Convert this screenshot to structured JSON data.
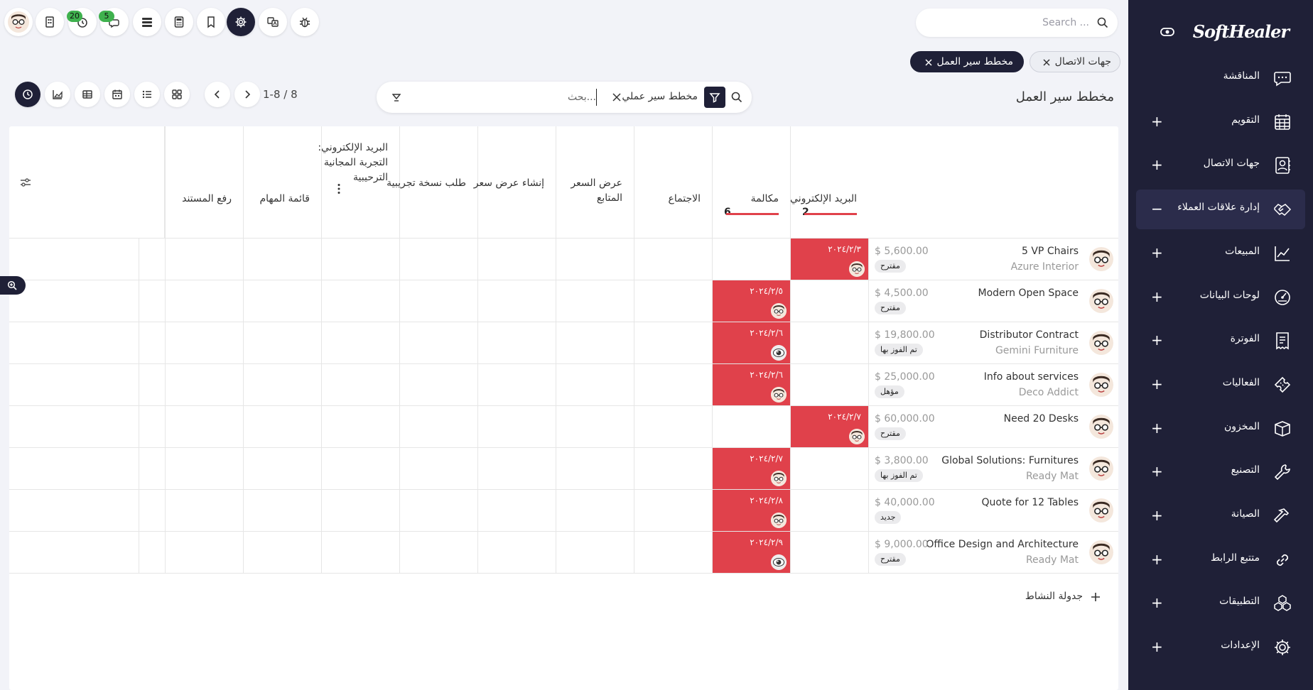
{
  "sidebar": {
    "brand": "SoftHealer",
    "items": [
      {
        "label": "المناقشة",
        "icon": "chat-icon",
        "expandable": false
      },
      {
        "label": "التقويم",
        "icon": "calendar-icon",
        "expandable": true
      },
      {
        "label": "جهات الاتصال",
        "icon": "contacts-icon",
        "expandable": true
      },
      {
        "label": "إدارة علاقات العملاء",
        "icon": "handshake-icon",
        "expandable": true,
        "active": true
      },
      {
        "label": "المبيعات",
        "icon": "sales-chart-icon",
        "expandable": true
      },
      {
        "label": "لوحات البيانات",
        "icon": "dashboard-icon",
        "expandable": true
      },
      {
        "label": "الفوترة",
        "icon": "invoice-icon",
        "expandable": true
      },
      {
        "label": "الفعاليات",
        "icon": "ticket-icon",
        "expandable": true
      },
      {
        "label": "المخزون",
        "icon": "box-icon",
        "expandable": true
      },
      {
        "label": "التصنيع",
        "icon": "wrench-icon",
        "expandable": true
      },
      {
        "label": "الصيانة",
        "icon": "hammer-icon",
        "expandable": true
      },
      {
        "label": "متتبع الرابط",
        "icon": "link-icon",
        "expandable": true
      },
      {
        "label": "التطبيقات",
        "icon": "apps-icon",
        "expandable": true
      },
      {
        "label": "الإعدادات",
        "icon": "gear-icon",
        "expandable": true
      }
    ]
  },
  "topbar": {
    "search_placeholder": "Search ...",
    "chat_badge": "5",
    "activity_badge": "20"
  },
  "breadcrumb_tabs": [
    {
      "label": "جهات الاتصال",
      "active": false
    },
    {
      "label": "مخطط سير العمل",
      "active": true
    }
  ],
  "control": {
    "page_title": "مخطط سير العمل",
    "facet": "مخطط سير عملي",
    "search_placeholder": "بحث...",
    "pager": "1-8 / 8"
  },
  "columns": [
    {
      "title": "البريد الإلكتروني",
      "count": "2",
      "bar": true
    },
    {
      "title": "مكالمة",
      "count": "6",
      "bar": true
    },
    {
      "title": "الاجتماع"
    },
    {
      "title": "عرض السعر المتابع"
    },
    {
      "title": "إنشاء عرض سعر"
    },
    {
      "title": "طلب نسخة تجريبية"
    },
    {
      "title": "البريد الإلكتروني: التجربة المجانية الترحيبية",
      "menu": true
    },
    {
      "title": "قائمة المهام"
    },
    {
      "title": "رفع المستند"
    }
  ],
  "records": [
    {
      "name": "5 VP Chairs",
      "sub": "Azure Interior",
      "amount": "$ 5,600.00",
      "stage": "مقترح",
      "col": 0,
      "date": "٢٠٢٤/٢/٣",
      "face": "glasses"
    },
    {
      "name": "Modern Open Space",
      "sub": "",
      "amount": "$ 4,500.00",
      "stage": "مقترح",
      "col": 1,
      "date": "٢٠٢٤/٢/٥",
      "face": "glasses"
    },
    {
      "name": "Distributor Contract",
      "sub": "Gemini Furniture",
      "amount": "$ 19,800.00",
      "stage": "تم الفوز بها",
      "col": 1,
      "date": "٢٠٢٤/٢/٦",
      "face": "eye"
    },
    {
      "name": "Info about services",
      "sub": "Deco Addict",
      "amount": "$ 25,000.00",
      "stage": "مؤهل",
      "col": 1,
      "date": "٢٠٢٤/٢/٦",
      "face": "glasses"
    },
    {
      "name": "Need 20 Desks",
      "sub": "",
      "amount": "$ 60,000.00",
      "stage": "مقترح",
      "col": 0,
      "date": "٢٠٢٤/٢/٧",
      "face": "glasses"
    },
    {
      "name": "Global Solutions: Furnitures",
      "sub": "Ready Mat",
      "amount": "$ 3,800.00",
      "stage": "تم الفوز بها",
      "col": 1,
      "date": "٢٠٢٤/٢/٧",
      "face": "glasses"
    },
    {
      "name": "Quote for 12 Tables",
      "sub": "",
      "amount": "$ 40,000.00",
      "stage": "جديد",
      "col": 1,
      "date": "٢٠٢٤/٢/٨",
      "face": "glasses"
    },
    {
      "name": "Office Design and Architecture",
      "sub": "Ready Mat",
      "amount": "$ 9,000.00",
      "stage": "مقترح",
      "col": 1,
      "date": "٢٠٢٤/٢/٩",
      "face": "eye"
    }
  ],
  "footer": {
    "add_activity": "جدولة النشاط"
  },
  "colors": {
    "sidebar": "#1f2037",
    "overdue": "#e0414b",
    "badge": "#3fb14e"
  }
}
